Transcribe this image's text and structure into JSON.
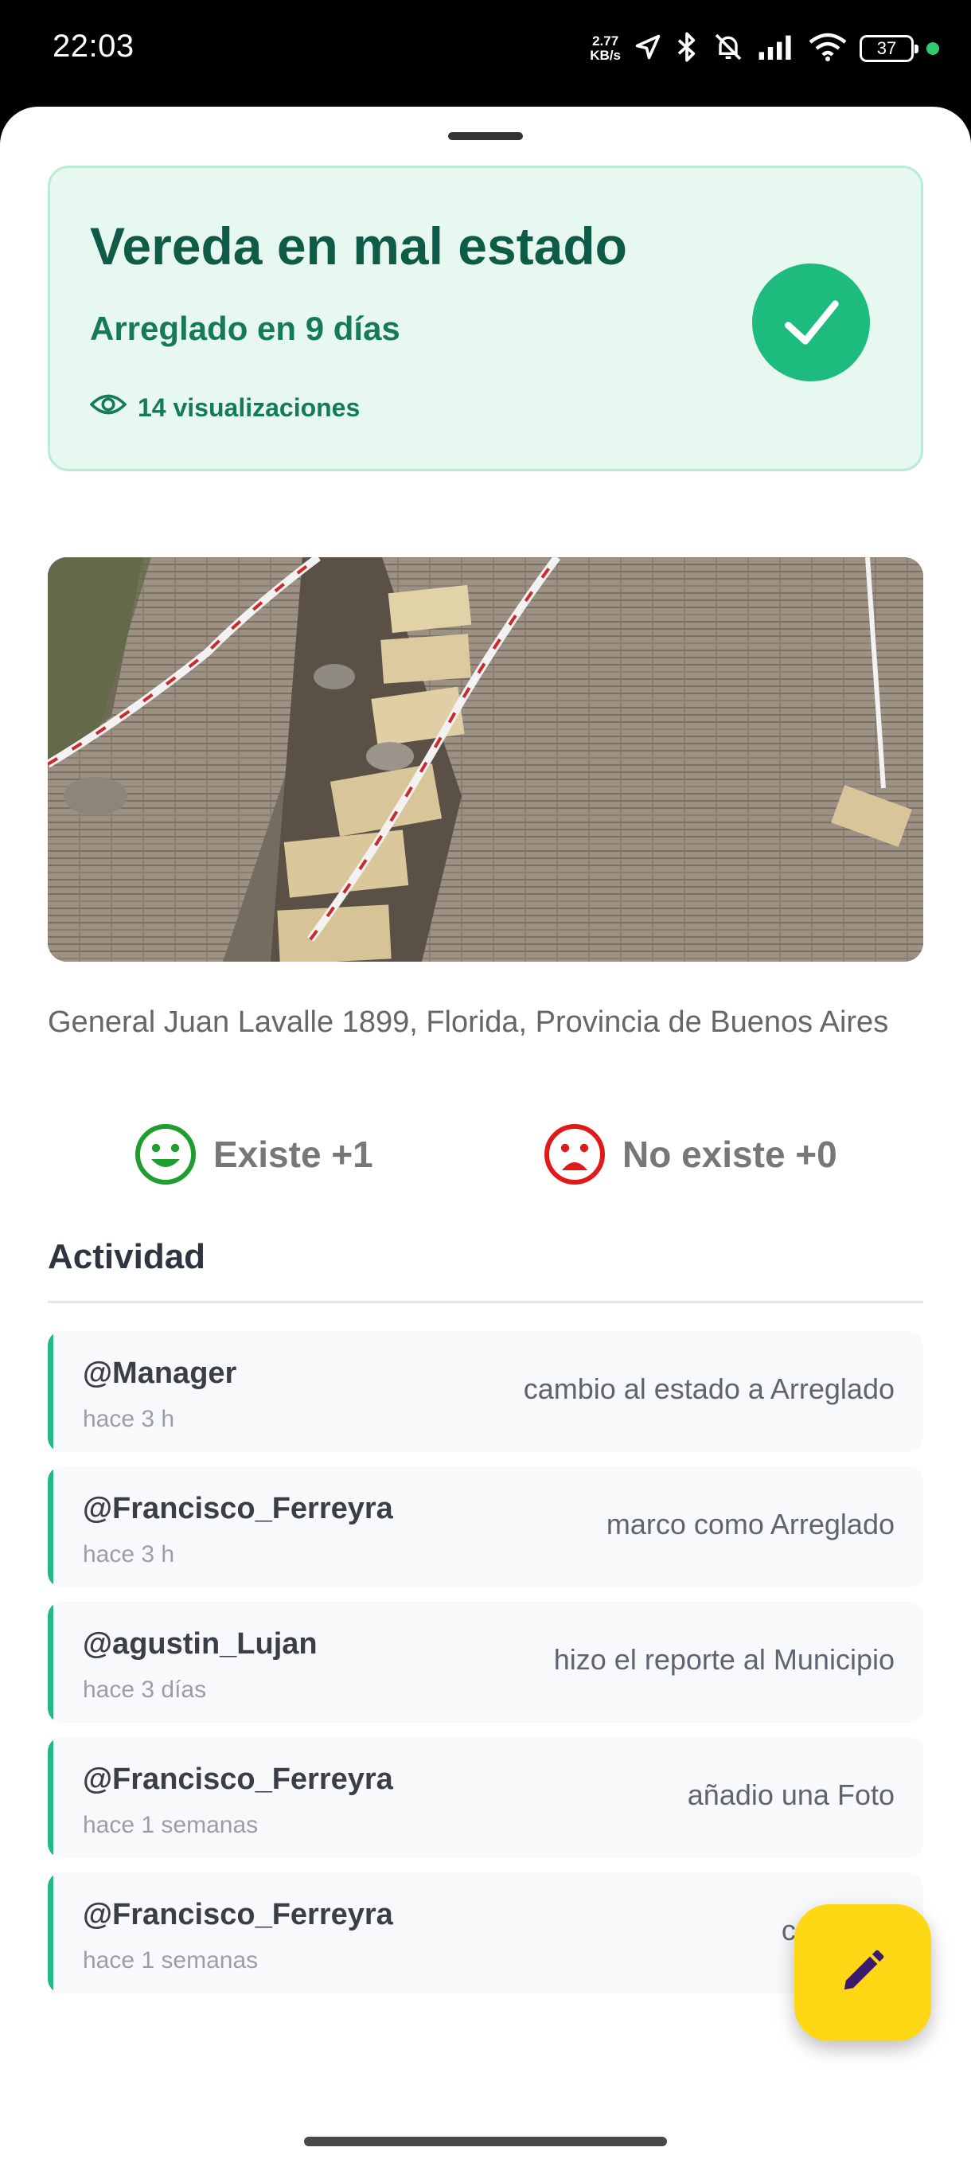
{
  "status_bar": {
    "time": "22:03",
    "net_speed_value": "2.77",
    "net_speed_unit": "KB/s",
    "battery": "37",
    "icons": [
      "location-arrow-icon",
      "bluetooth-icon",
      "muted-bell-icon",
      "signal-icon",
      "wifi-icon",
      "battery-icon"
    ]
  },
  "status_card": {
    "title": "Vereda en mal estado",
    "subtitle": "Arreglado en 9 días",
    "views": "14 visualizaciones",
    "badge_icon": "check-icon",
    "colors": {
      "background": "#e6f8ef",
      "title": "#0e5c47",
      "accent": "#1dbb7e"
    }
  },
  "photo": {
    "subject": "broken-sidewalk-photo"
  },
  "address": "General Juan Lavalle 1899, Florida, Provincia de Buenos Aires",
  "votes": {
    "yes_label": "Existe +1",
    "no_label": "No existe +0",
    "yes_icon": "happy-face-icon",
    "no_icon": "sad-face-icon",
    "colors": {
      "yes": "#1e9e2f",
      "no": "#e01a1a"
    }
  },
  "activity": {
    "title": "Actividad",
    "items": [
      {
        "user": "@Manager",
        "time": "hace 3 h",
        "action": "cambio al estado a Arreglado"
      },
      {
        "user": "@Francisco_Ferreyra",
        "time": "hace 3 h",
        "action": "marco como Arreglado"
      },
      {
        "user": "@agustin_Lujan",
        "time": "hace 3 días",
        "action": "hizo el reporte al Municipio"
      },
      {
        "user": "@Francisco_Ferreyra",
        "time": "hace 1 semanas",
        "action": "añadio una Foto"
      },
      {
        "user": "@Francisco_Ferreyra",
        "time": "hace 1 semanas",
        "action": "creo un r"
      }
    ]
  },
  "fab": {
    "icon": "pencil-icon",
    "color": "#ffd815"
  }
}
